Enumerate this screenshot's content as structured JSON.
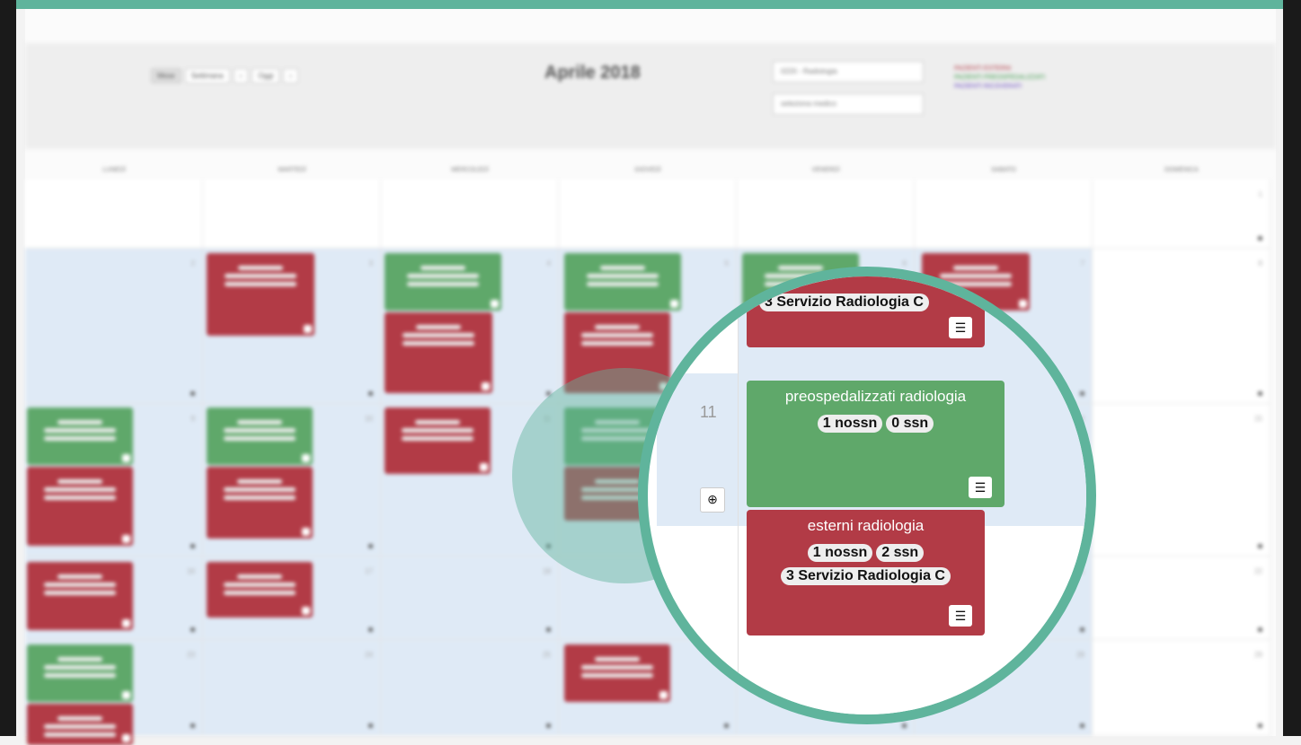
{
  "calendar": {
    "title": "Aprile 2018",
    "view_buttons": [
      "Mese",
      "Settimana",
      "‹",
      "Oggi",
      "›"
    ],
    "service_select": "0220 - Radiologia",
    "doctor_select": "seleziona medico",
    "legend": [
      "PAZIENTI ESTERNI",
      "PAZIENTI PREOSPEDALIZZATI",
      "PAZIENTI RICOVERATI"
    ],
    "weekdays": [
      "LUNEDÌ",
      "MARTEDÌ",
      "MERCOLEDÌ",
      "GIOVEDÌ",
      "VENERDÌ",
      "SABATO",
      "DOMENICA"
    ],
    "week_rows": [
      [
        "",
        "",
        "",
        "",
        "",
        "",
        "1"
      ],
      [
        "2",
        "3",
        "4",
        "5",
        "6",
        "7",
        "8"
      ],
      [
        "9",
        "10",
        "11",
        "12",
        "13",
        "14",
        "15"
      ],
      [
        "16",
        "17",
        "18",
        "19",
        "20",
        "21",
        "22"
      ],
      [
        "23",
        "24",
        "25",
        "26",
        "27",
        "28",
        "29"
      ]
    ]
  },
  "zoom": {
    "top_event_text": "3 Servizio Radiologia C",
    "day_number": "11",
    "add_icon": "plus-circle-icon",
    "list_icon": "list-icon",
    "event_pre": {
      "title": "preospedalizzati radiologia",
      "pills": [
        "1 nossn",
        "0 ssn"
      ]
    },
    "event_ext": {
      "title": "esterni radiologia",
      "pills": [
        "1 nossn",
        "2 ssn"
      ],
      "line": "3 Servizio Radiologia C"
    }
  },
  "colors": {
    "red": "#b23b46",
    "green": "#5fa86a",
    "accent": "#5fb49c"
  }
}
